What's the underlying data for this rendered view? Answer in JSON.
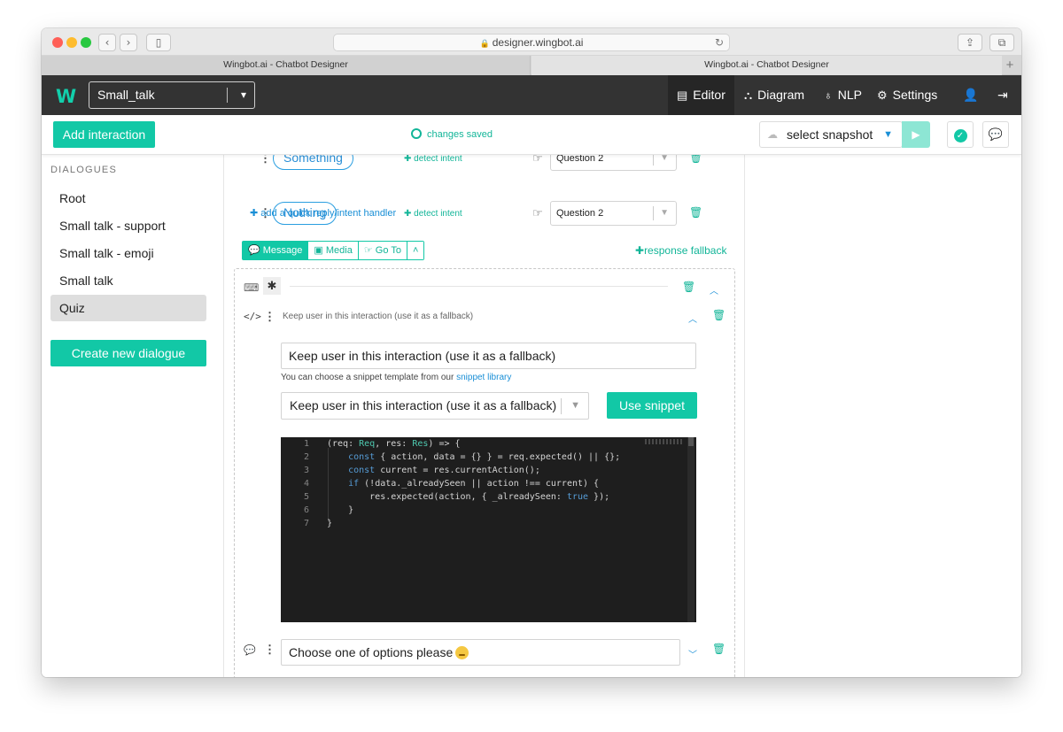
{
  "browser": {
    "url": "designer.wingbot.ai",
    "tabs": [
      "Wingbot.ai - Chatbot Designer",
      "Wingbot.ai - Chatbot Designer"
    ],
    "colors": {
      "close": "#ff5f57",
      "minimize": "#febc2e",
      "maximize": "#28c840"
    }
  },
  "app": {
    "logo": "W",
    "bot_name": "Small_talk",
    "nav": [
      "Editor",
      "Diagram",
      "NLP",
      "Settings"
    ],
    "accent": "#12c8a6",
    "nav_bg": "#333333"
  },
  "actions": {
    "add_interaction": "Add interaction",
    "status": "changes saved",
    "snapshot": "select snapshot"
  },
  "sidebar": {
    "heading": "DIALOGUES",
    "items": [
      "Root",
      "Small talk - support",
      "Small talk - emoji",
      "Small talk",
      "Quiz"
    ],
    "active": "Quiz",
    "create_button": "Create new dialogue"
  },
  "quick_replies": [
    {
      "label": "Something",
      "detect": "detect intent",
      "target": "Question 2"
    },
    {
      "label": "Nothing",
      "detect": "detect intent",
      "target": "Question 2"
    }
  ],
  "add_quick_reply": "add a quick reply/intent handler",
  "response_tabs": [
    "Message",
    "Media",
    "Go To"
  ],
  "response_fallback": "response fallback",
  "snippet": {
    "header": "Keep user in this interaction (use it as a fallback)",
    "name_value": "Keep user in this interaction (use it as a fallback)",
    "hint_prefix": "You can choose a snippet template from our ",
    "hint_link": "snippet library",
    "template_selected": "Keep user in this interaction (use it as a fallback)",
    "use_button": "Use snippet"
  },
  "code": {
    "line_numbers": [
      "1",
      "2",
      "3",
      "4",
      "5",
      "6",
      "7"
    ],
    "lines": [
      "(req: Req, res: Res) => {",
      "    const { action, data = {} } = req.expected() || {};",
      "    const current = res.currentAction();",
      "    if (!data._alreadySeen || action !== current) {",
      "        res.expected(action, { _alreadySeen: true });",
      "    }",
      "}"
    ]
  },
  "message": {
    "text": "Choose one of options please"
  }
}
